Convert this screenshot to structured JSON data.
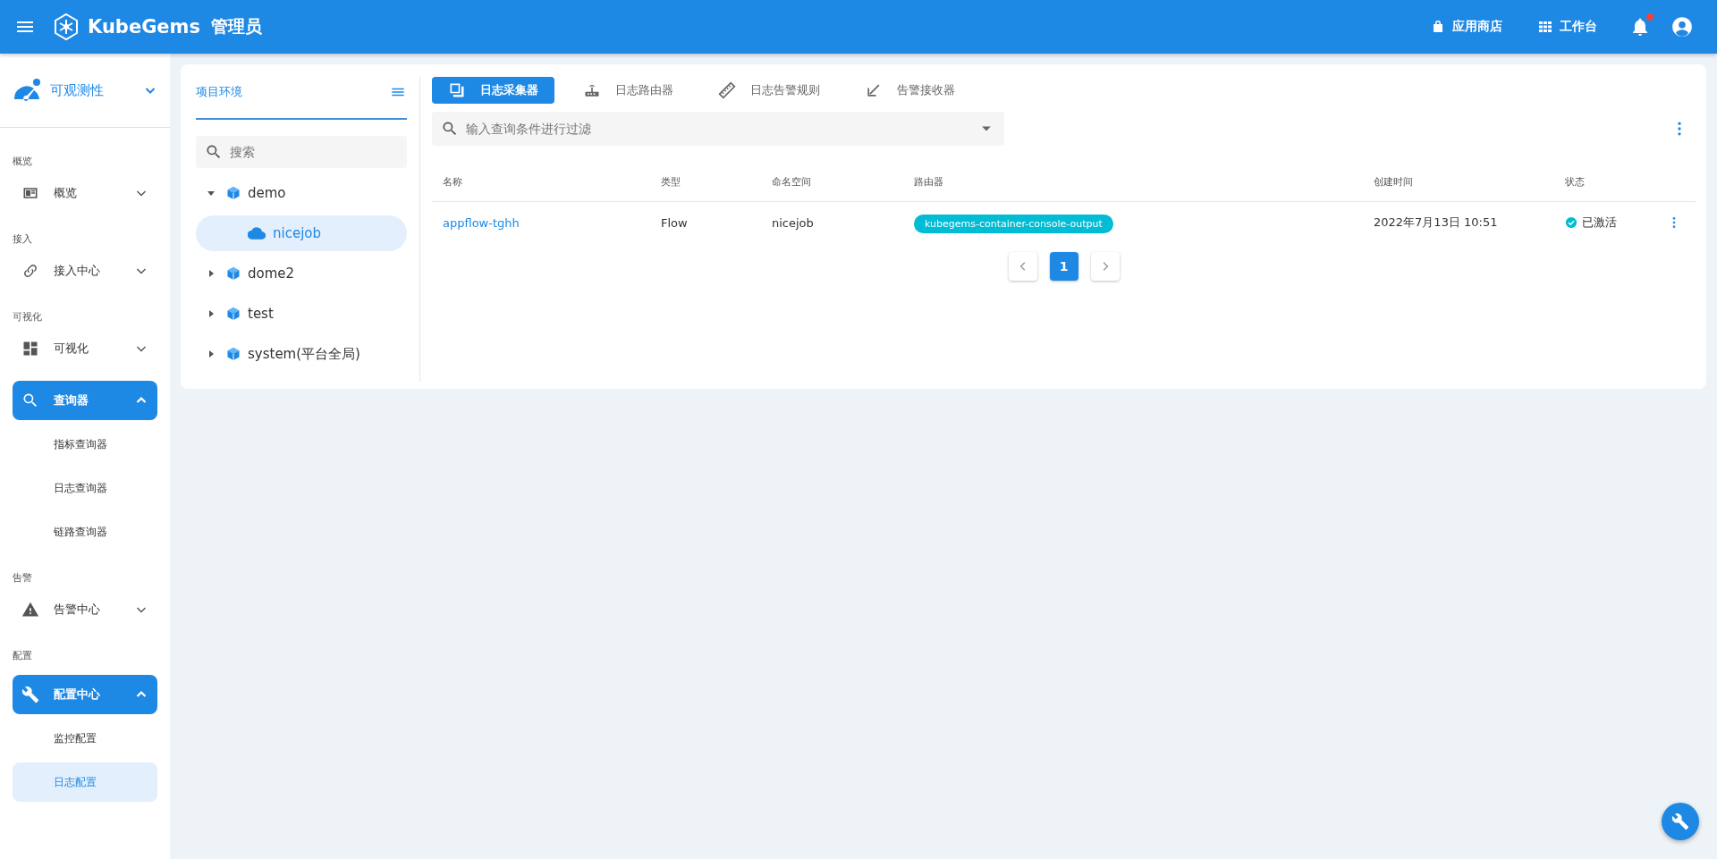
{
  "header": {
    "brand": "KubeGems",
    "role": "管理员",
    "actions": [
      {
        "label": "应用商店"
      },
      {
        "label": "工作台"
      }
    ],
    "notification_dot": true
  },
  "sidebar": {
    "module": "可观测性",
    "sections": [
      {
        "title": "概览",
        "items": [
          {
            "label": "概览",
            "expanded": false
          }
        ]
      },
      {
        "title": "接入",
        "items": [
          {
            "label": "接入中心",
            "expanded": false
          }
        ]
      },
      {
        "title": "可视化",
        "items": [
          {
            "label": "可视化",
            "expanded": false
          }
        ]
      },
      {
        "items": [
          {
            "label": "查询器",
            "expanded": true,
            "children": [
              {
                "label": "指标查询器",
                "selected": false
              },
              {
                "label": "日志查询器",
                "selected": false
              },
              {
                "label": "链路查询器",
                "selected": false
              }
            ]
          }
        ]
      },
      {
        "title": "告警",
        "items": [
          {
            "label": "告警中心",
            "expanded": false
          }
        ]
      },
      {
        "title": "配置",
        "items": [
          {
            "label": "配置中心",
            "expanded": true,
            "children": [
              {
                "label": "监控配置",
                "selected": false
              },
              {
                "label": "日志配置",
                "selected": true
              }
            ]
          }
        ]
      }
    ]
  },
  "env_panel": {
    "title": "项目环境",
    "search": {
      "placeholder": "搜索"
    },
    "tree": [
      {
        "label": "demo",
        "expanded": true,
        "selected": false,
        "children": [
          {
            "label": "nicejob",
            "selected": true
          }
        ]
      },
      {
        "label": "dome2",
        "expanded": false,
        "selected": false
      },
      {
        "label": "test",
        "expanded": false,
        "selected": false
      },
      {
        "label": "system(平台全局)",
        "expanded": false,
        "selected": false
      }
    ]
  },
  "tabs": [
    {
      "label": "日志采集器",
      "selected": true
    },
    {
      "label": "日志路由器",
      "selected": false
    },
    {
      "label": "日志告警规则",
      "selected": false
    },
    {
      "label": "告警接收器",
      "selected": false
    }
  ],
  "filter": {
    "placeholder": "输入查询条件进行过滤"
  },
  "table": {
    "columns": [
      "名称",
      "类型",
      "命名空间",
      "路由器",
      "创建时间",
      "状态"
    ],
    "rows": [
      {
        "name": "appflow-tghh",
        "type": "Flow",
        "namespace": "nicejob",
        "router": "kubegems-container-console-output",
        "created": "2022年7月13日 10:51",
        "status": "已激活",
        "active": true
      }
    ]
  },
  "pagination": {
    "pages": [
      {
        "label": "1",
        "selected": true
      }
    ]
  }
}
